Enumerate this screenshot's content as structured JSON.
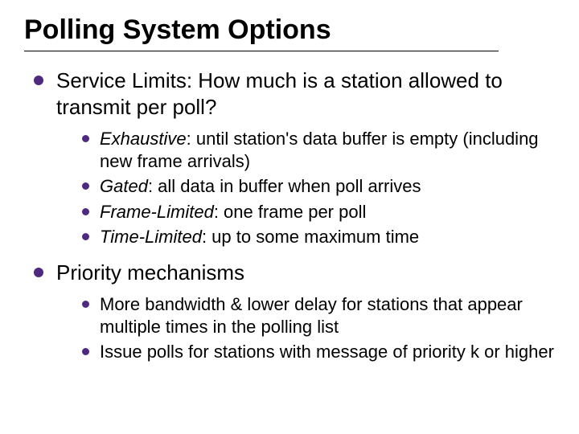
{
  "title": "Polling System Options",
  "bullets": {
    "service": {
      "heading": "Service Limits:  How much is a station allowed to transmit per poll?",
      "items": [
        {
          "term": "Exhaustive",
          "rest": ":  until station's data buffer is empty (including new frame arrivals)"
        },
        {
          "term": "Gated",
          "rest": ":  all data in buffer when poll arrives"
        },
        {
          "term": "Frame-Limited",
          "rest": ":  one frame per poll"
        },
        {
          "term": "Time-Limited",
          "rest": ":  up to some maximum time"
        }
      ]
    },
    "priority": {
      "heading": "Priority mechanisms",
      "items": [
        "More bandwidth & lower delay for stations that appear multiple times in the polling list",
        "Issue polls for stations with message of priority k or higher"
      ]
    }
  }
}
